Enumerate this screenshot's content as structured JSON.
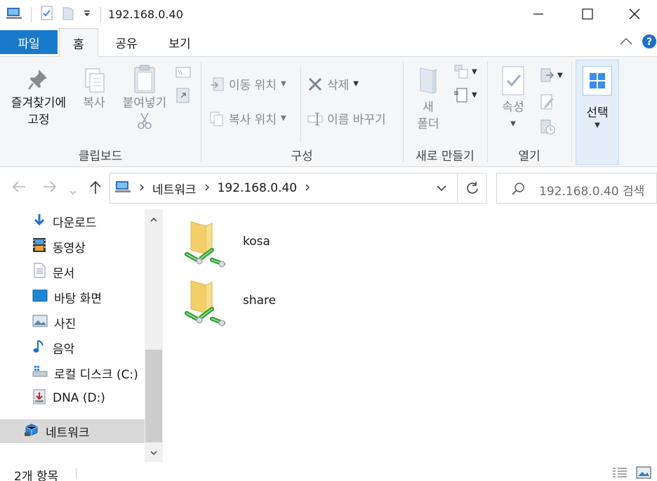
{
  "window": {
    "title": "192.168.0.40"
  },
  "tabs": {
    "file": "파일",
    "home": "홈",
    "share": "공유",
    "view": "보기"
  },
  "ribbon": {
    "clipboard": {
      "label": "클립보드",
      "pin_line1": "즐겨찾기에",
      "pin_line2": "고정",
      "copy": "복사",
      "paste": "붙여넣기"
    },
    "organize": {
      "label": "구성",
      "move_to": "이동 위치",
      "copy_to": "복사 위치",
      "delete": "삭제",
      "rename": "이름 바꾸기"
    },
    "new": {
      "label": "새로 만들기",
      "new_line1": "새",
      "new_line2": "폴더"
    },
    "open": {
      "label": "열기",
      "properties": "속성"
    },
    "select": {
      "label": "선택"
    }
  },
  "address": {
    "crumbs": [
      "네트워크",
      "192.168.0.40"
    ],
    "search_placeholder": "192.168.0.40 검색"
  },
  "sidebar": {
    "items": [
      {
        "label": "다운로드",
        "icon": "download-icon"
      },
      {
        "label": "동영상",
        "icon": "video-icon"
      },
      {
        "label": "문서",
        "icon": "document-icon"
      },
      {
        "label": "바탕 화면",
        "icon": "desktop-icon"
      },
      {
        "label": "사진",
        "icon": "picture-icon"
      },
      {
        "label": "음악",
        "icon": "music-icon"
      },
      {
        "label": "로컬 디스크 (C:)",
        "icon": "local-disk-icon"
      },
      {
        "label": "DNA (D:)",
        "icon": "usb-drive-icon"
      },
      {
        "label": "네트워크",
        "icon": "network-icon",
        "selected": true
      }
    ]
  },
  "content": {
    "items": [
      {
        "name": "kosa",
        "icon": "shared-folder-icon"
      },
      {
        "name": "share",
        "icon": "shared-folder-icon"
      }
    ]
  },
  "status": {
    "item_count": "2개 항목"
  },
  "colors": {
    "accent": "#1979ca",
    "selection": "#d9d9d9",
    "ribbon_bg": "#f5f6f7"
  }
}
